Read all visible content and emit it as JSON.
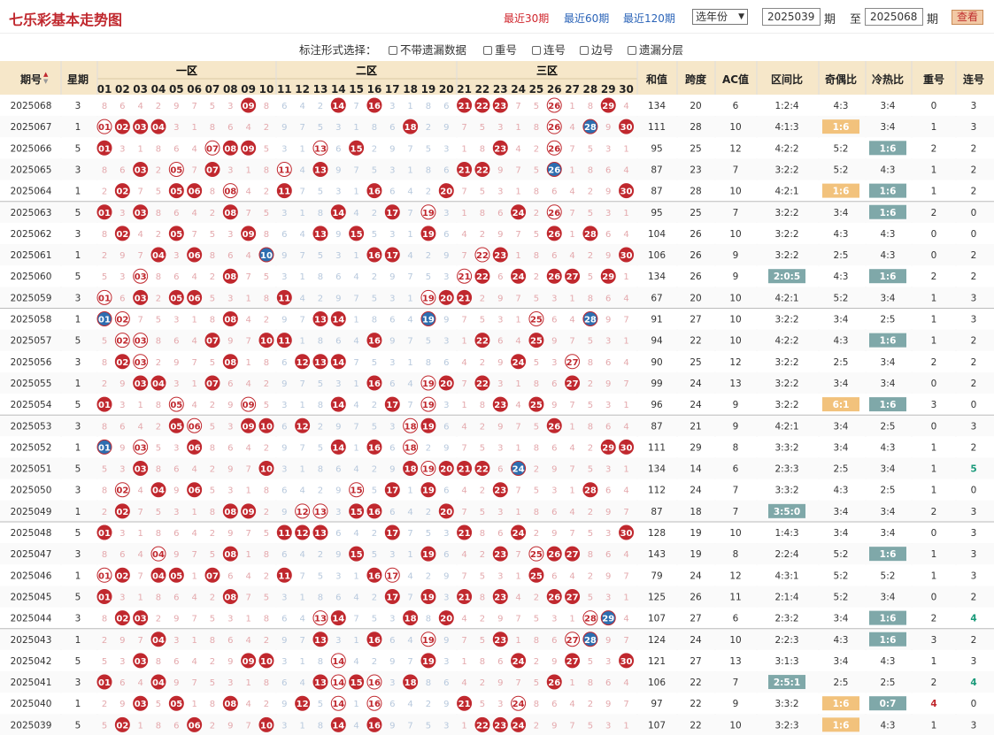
{
  "title": "七乐彩基本走势图",
  "period_links": [
    "最近30期",
    "最近60期",
    "最近120期"
  ],
  "year_select": "选年份",
  "from_period": "2025039",
  "period_unit_a": "期",
  "to_label": "至",
  "to_period": "2025068",
  "period_unit_b": "期",
  "query_button": "查看",
  "options_label": "标注形式选择：",
  "options": [
    "不带遗漏数据",
    "重号",
    "连号",
    "边号",
    "遗漏分层"
  ],
  "headers": {
    "period": "期号",
    "week": "星期",
    "zone1": "一区",
    "zone2": "二区",
    "zone3": "三区",
    "sum": "和值",
    "span": "跨度",
    "ac": "AC值",
    "zone_ratio": "区间比",
    "odd_even": "奇偶比",
    "hot_cold": "冷热比",
    "repeat": "重号",
    "consec": "连号"
  },
  "colors": {
    "red": "#c0282e",
    "blue": "#2d6eb0",
    "orange": "#f2c27c",
    "teal": "#7fa8a9",
    "header": "#f6e7c9"
  },
  "rows": [
    {
      "p": "2025068",
      "w": "3",
      "b": [
        9,
        14,
        16,
        21,
        22,
        23,
        26,
        29
      ],
      "s": "134",
      "k": "20",
      "ac": "6",
      "z": "1:2:4",
      "oe": "4:3",
      "hc": "3:4",
      "r": "0",
      "c": "3"
    },
    {
      "p": "2025067",
      "w": "1",
      "b": [
        1,
        2,
        3,
        4,
        18,
        26,
        28,
        30
      ],
      "s": "111",
      "k": "28",
      "ac": "10",
      "z": "4:1:3",
      "oe": "1:6",
      "hc": "3:4",
      "r": "1",
      "c": "3"
    },
    {
      "p": "2025066",
      "w": "5",
      "b": [
        1,
        7,
        8,
        9,
        13,
        15,
        23,
        26
      ],
      "s": "95",
      "k": "25",
      "ac": "12",
      "z": "4:2:2",
      "oe": "5:2",
      "hc": "1:6",
      "r": "2",
      "c": "2"
    },
    {
      "p": "2025065",
      "w": "3",
      "b": [
        3,
        5,
        7,
        11,
        13,
        21,
        22,
        26
      ],
      "s": "87",
      "k": "23",
      "ac": "7",
      "z": "3:2:2",
      "oe": "5:2",
      "hc": "4:3",
      "r": "1",
      "c": "2"
    },
    {
      "p": "2025064",
      "w": "1",
      "b": [
        2,
        5,
        6,
        8,
        11,
        16,
        20,
        30
      ],
      "s": "87",
      "k": "28",
      "ac": "10",
      "z": "4:2:1",
      "oe": "1:6",
      "hc": "1:6",
      "r": "1",
      "c": "2"
    },
    {
      "p": "2025063",
      "w": "5",
      "b": [
        1,
        3,
        8,
        14,
        17,
        19,
        24,
        26
      ],
      "s": "95",
      "k": "25",
      "ac": "7",
      "z": "3:2:2",
      "oe": "3:4",
      "hc": "1:6",
      "r": "2",
      "c": "0"
    },
    {
      "p": "2025062",
      "w": "3",
      "b": [
        2,
        5,
        9,
        13,
        15,
        19,
        26,
        28
      ],
      "s": "104",
      "k": "26",
      "ac": "10",
      "z": "3:2:2",
      "oe": "4:3",
      "hc": "4:3",
      "r": "0",
      "c": "0"
    },
    {
      "p": "2025061",
      "w": "1",
      "b": [
        4,
        6,
        10,
        16,
        17,
        22,
        23,
        30
      ],
      "s": "106",
      "k": "26",
      "ac": "9",
      "z": "3:2:2",
      "oe": "2:5",
      "hc": "4:3",
      "r": "0",
      "c": "2"
    },
    {
      "p": "2025060",
      "w": "5",
      "b": [
        3,
        8,
        21,
        22,
        24,
        26,
        27,
        29
      ],
      "s": "134",
      "k": "26",
      "ac": "9",
      "z": "2:0:5",
      "oe": "4:3",
      "hc": "1:6",
      "r": "2",
      "c": "2"
    },
    {
      "p": "2025059",
      "w": "3",
      "b": [
        1,
        3,
        5,
        6,
        11,
        19,
        20,
        21
      ],
      "s": "67",
      "k": "20",
      "ac": "10",
      "z": "4:2:1",
      "oe": "5:2",
      "hc": "3:4",
      "r": "1",
      "c": "3"
    },
    {
      "p": "2025058",
      "w": "1",
      "b": [
        1,
        2,
        8,
        13,
        14,
        19,
        25,
        28
      ],
      "s": "91",
      "k": "27",
      "ac": "10",
      "z": "3:2:2",
      "oe": "3:4",
      "hc": "2:5",
      "r": "1",
      "c": "3"
    },
    {
      "p": "2025057",
      "w": "5",
      "b": [
        2,
        3,
        7,
        10,
        11,
        16,
        22,
        25
      ],
      "s": "94",
      "k": "22",
      "ac": "10",
      "z": "4:2:2",
      "oe": "4:3",
      "hc": "1:6",
      "r": "1",
      "c": "2"
    },
    {
      "p": "2025056",
      "w": "3",
      "b": [
        2,
        3,
        8,
        12,
        13,
        14,
        24,
        27
      ],
      "s": "90",
      "k": "25",
      "ac": "12",
      "z": "3:2:2",
      "oe": "2:5",
      "hc": "3:4",
      "r": "2",
      "c": "2"
    },
    {
      "p": "2025055",
      "w": "1",
      "b": [
        3,
        4,
        7,
        16,
        19,
        20,
        22,
        27
      ],
      "s": "99",
      "k": "24",
      "ac": "13",
      "z": "3:2:2",
      "oe": "3:4",
      "hc": "3:4",
      "r": "0",
      "c": "2"
    },
    {
      "p": "2025054",
      "w": "5",
      "b": [
        1,
        5,
        9,
        14,
        17,
        19,
        23,
        25
      ],
      "s": "96",
      "k": "24",
      "ac": "9",
      "z": "3:2:2",
      "oe": "6:1",
      "hc": "1:6",
      "r": "3",
      "c": "0"
    },
    {
      "p": "2025053",
      "w": "3",
      "b": [
        5,
        6,
        9,
        10,
        12,
        18,
        19,
        26
      ],
      "s": "87",
      "k": "21",
      "ac": "9",
      "z": "4:2:1",
      "oe": "3:4",
      "hc": "2:5",
      "r": "0",
      "c": "3"
    },
    {
      "p": "2025052",
      "w": "1",
      "b": [
        1,
        3,
        6,
        14,
        16,
        18,
        29,
        30
      ],
      "s": "111",
      "k": "29",
      "ac": "8",
      "z": "3:3:2",
      "oe": "3:4",
      "hc": "4:3",
      "r": "1",
      "c": "2"
    },
    {
      "p": "2025051",
      "w": "5",
      "b": [
        3,
        10,
        18,
        19,
        20,
        21,
        22,
        24
      ],
      "s": "134",
      "k": "14",
      "ac": "6",
      "z": "2:3:3",
      "oe": "2:5",
      "hc": "3:4",
      "r": "1",
      "c": "5"
    },
    {
      "p": "2025050",
      "w": "3",
      "b": [
        2,
        4,
        6,
        15,
        17,
        19,
        23,
        28
      ],
      "s": "112",
      "k": "24",
      "ac": "7",
      "z": "3:3:2",
      "oe": "4:3",
      "hc": "2:5",
      "r": "1",
      "c": "0"
    },
    {
      "p": "2025049",
      "w": "1",
      "b": [
        2,
        8,
        9,
        12,
        13,
        15,
        16,
        20
      ],
      "s": "87",
      "k": "18",
      "ac": "7",
      "z": "3:5:0",
      "oe": "3:4",
      "hc": "3:4",
      "r": "2",
      "c": "3"
    },
    {
      "p": "2025048",
      "w": "5",
      "b": [
        1,
        11,
        12,
        13,
        17,
        21,
        24,
        30
      ],
      "s": "128",
      "k": "19",
      "ac": "10",
      "z": "1:4:3",
      "oe": "3:4",
      "hc": "3:4",
      "r": "0",
      "c": "3"
    },
    {
      "p": "2025047",
      "w": "3",
      "b": [
        4,
        8,
        15,
        19,
        23,
        25,
        26,
        27
      ],
      "s": "143",
      "k": "19",
      "ac": "8",
      "z": "2:2:4",
      "oe": "5:2",
      "hc": "1:6",
      "r": "1",
      "c": "3"
    },
    {
      "p": "2025046",
      "w": "1",
      "b": [
        1,
        2,
        4,
        5,
        7,
        11,
        16,
        17,
        25
      ],
      "s": "79",
      "k": "24",
      "ac": "12",
      "z": "4:3:1",
      "oe": "5:2",
      "hc": "5:2",
      "r": "1",
      "c": "3"
    },
    {
      "p": "2025045",
      "w": "5",
      "b": [
        1,
        8,
        17,
        19,
        21,
        23,
        26,
        27
      ],
      "s": "125",
      "k": "26",
      "ac": "11",
      "z": "2:1:4",
      "oe": "5:2",
      "hc": "3:4",
      "r": "0",
      "c": "2"
    },
    {
      "p": "2025044",
      "w": "3",
      "b": [
        2,
        3,
        13,
        14,
        18,
        20,
        28,
        29
      ],
      "s": "107",
      "k": "27",
      "ac": "6",
      "z": "2:3:2",
      "oe": "3:4",
      "hc": "1:6",
      "r": "2",
      "c": "4"
    },
    {
      "p": "2025043",
      "w": "1",
      "b": [
        4,
        13,
        16,
        19,
        23,
        27,
        28
      ],
      "s": "124",
      "k": "24",
      "ac": "10",
      "z": "2:2:3",
      "oe": "4:3",
      "hc": "1:6",
      "r": "3",
      "c": "2"
    },
    {
      "p": "2025042",
      "w": "5",
      "b": [
        3,
        9,
        10,
        14,
        19,
        24,
        27,
        30
      ],
      "s": "121",
      "k": "27",
      "ac": "13",
      "z": "3:1:3",
      "oe": "3:4",
      "hc": "4:3",
      "r": "1",
      "c": "3"
    },
    {
      "p": "2025041",
      "w": "3",
      "b": [
        1,
        4,
        13,
        14,
        15,
        16,
        18,
        26
      ],
      "s": "106",
      "k": "22",
      "ac": "7",
      "z": "2:5:1",
      "oe": "2:5",
      "hc": "2:5",
      "r": "2",
      "c": "4"
    },
    {
      "p": "2025040",
      "w": "1",
      "b": [
        3,
        5,
        8,
        12,
        14,
        16,
        21,
        24
      ],
      "s": "97",
      "k": "22",
      "ac": "9",
      "z": "3:3:2",
      "oe": "1:6",
      "hc": "0:7",
      "r": "4",
      "c": "0"
    },
    {
      "p": "2025039",
      "w": "5",
      "b": [
        2,
        6,
        10,
        14,
        16,
        22,
        23,
        24
      ],
      "s": "107",
      "k": "22",
      "ac": "10",
      "z": "3:2:3",
      "oe": "1:6",
      "hc": "4:3",
      "r": "1",
      "c": "3"
    }
  ]
}
